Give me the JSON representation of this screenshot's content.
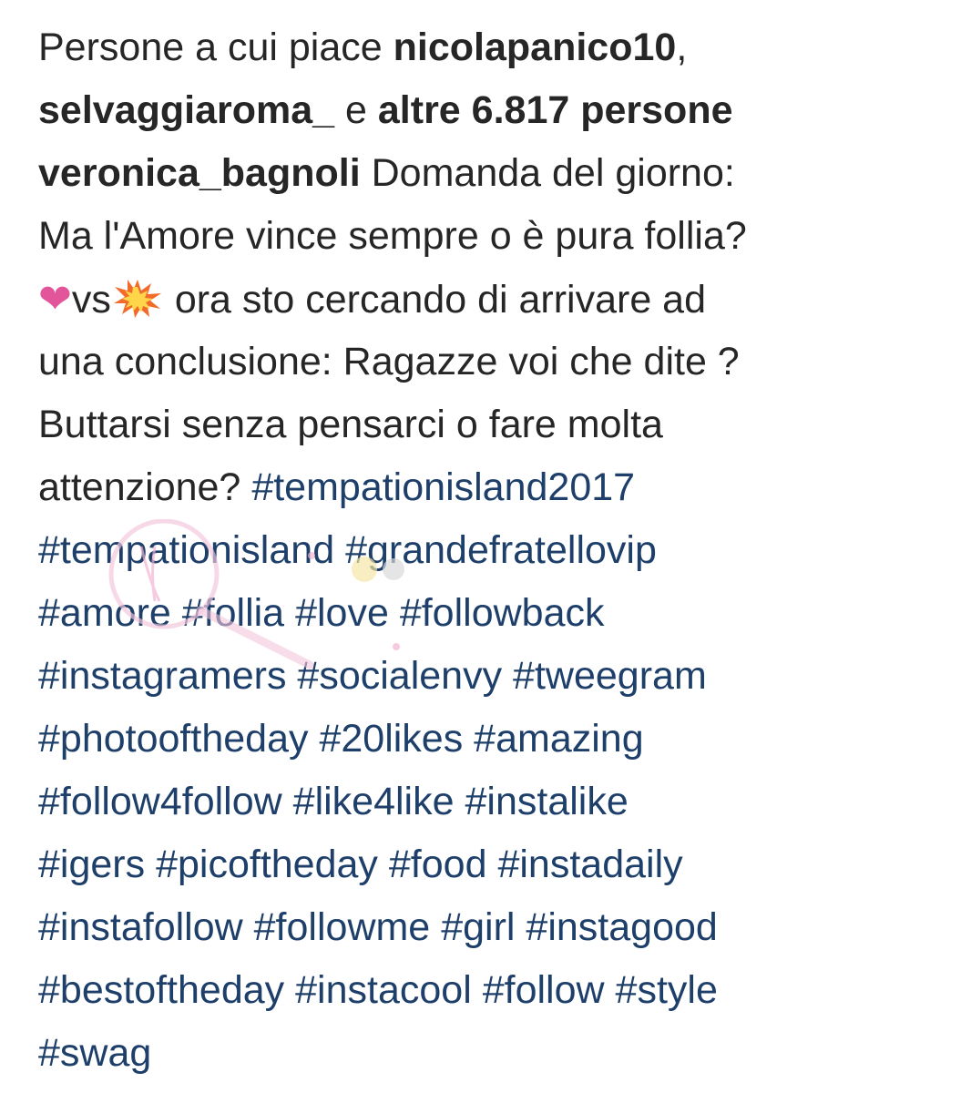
{
  "likes": {
    "prefix": "Persone a cui piace",
    "user1": "nicolapanico10",
    "comma": ",",
    "user2": "selvaggiaroma_",
    "connector": "e",
    "others": "altre 6.817 persone"
  },
  "caption": {
    "author": "veronica_bagnoli",
    "text_line1": "Domanda del giorno:",
    "text_line2": "Ma l'Amore vince sempre o è pura follia?",
    "emoji_heart": "❤",
    "vs": "vs",
    "emoji_burst": "collision-emoji",
    "text_line3": "ora sto cercando di arrivare ad",
    "text_line4": "una conclusione: Ragazze voi che dite ?",
    "text_line5": "Buttarsi senza pensarci o fare molta",
    "text_line6": "attenzione?"
  },
  "hashtags": [
    "#tempationisland2017",
    "#tempationisland",
    "#grandefratellovip",
    "#amore",
    "#follia",
    "#love",
    "#followback",
    "#instagramers",
    "#socialenvy",
    "#tweegram",
    "#photooftheday",
    "#20likes",
    "#amazing",
    "#follow4follow",
    "#like4like",
    "#instalike",
    "#igers",
    "#picoftheday",
    "#food",
    "#instadaily",
    "#instafollow",
    "#followme",
    "#girl",
    "#instagood",
    "#bestoftheday",
    "#instacool",
    "#follow",
    "#style",
    "#swag"
  ],
  "colors": {
    "text": "#262626",
    "hashtag": "#1d3f6a",
    "heart": "#e2559a",
    "background": "#ffffff"
  }
}
